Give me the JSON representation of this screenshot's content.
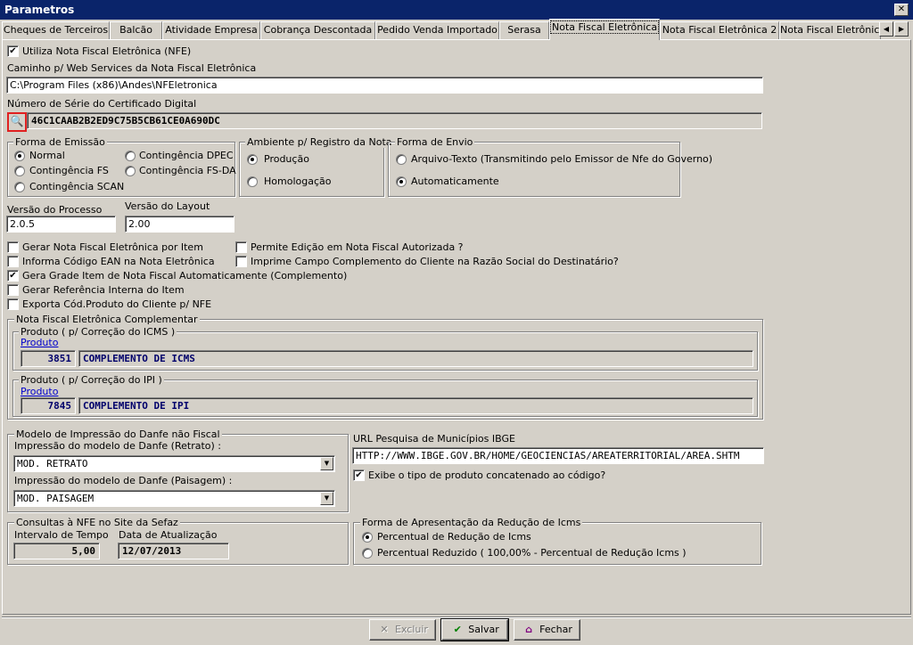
{
  "window": {
    "title": "Parametros",
    "close_glyph": "✕"
  },
  "tabs": [
    "Cheques de Terceiros",
    "Balcão",
    "Atividade Empresa",
    "Cobrança Descontada",
    "Pedido Venda Importado",
    "Serasa",
    "Nota Fiscal Eletrônica",
    "Nota Fiscal Eletrônica 2",
    "Nota Fiscal Eletrônica"
  ],
  "active_tab_index": 6,
  "tab_arrows": {
    "left": "◀",
    "right": "▶"
  },
  "nfe": {
    "use_nfe_label": "Utiliza Nota Fiscal Eletrônica (NFE)",
    "use_nfe_checked": true,
    "ws_path_label": "Caminho p/ Web Services da Nota Fiscal Eletrônica",
    "ws_path_value": "C:\\Program Files (x86)\\Andes\\NFEletronica",
    "cert_serial_label": "Número de Série do Certificado Digital",
    "cert_serial_value": "46C1CAAB2B2ED9C75B5CB61CE0A690DC",
    "cert_button_icon": "magnifier-icon"
  },
  "emissao": {
    "title": "Forma de Emissão",
    "options": [
      "Normal",
      "Contingência FS",
      "Contingência SCAN",
      "Contingência DPEC",
      "Contingência FS-DA"
    ],
    "selected": "Normal"
  },
  "ambiente": {
    "title": "Ambiente p/ Registro da Nota",
    "options": [
      "Produção",
      "Homologação"
    ],
    "selected": "Produção"
  },
  "envio": {
    "title": "Forma de Envio",
    "options": [
      "Arquivo-Texto (Transmitindo pelo Emissor de Nfe do Governo)",
      "Automaticamente"
    ],
    "selected": "Automaticamente"
  },
  "versao": {
    "processo_label": "Versão do Processo",
    "processo_value": "2.0.5",
    "layout_label": "Versão do Layout",
    "layout_value": "2.00"
  },
  "checks_left": [
    {
      "label": "Gerar Nota Fiscal Eletrônica por Item",
      "checked": false
    },
    {
      "label": "Informa Código EAN na Nota Eletrônica",
      "checked": false
    },
    {
      "label": "Gera Grade Item de Nota Fiscal Automaticamente (Complemento)",
      "checked": true
    },
    {
      "label": "Gerar Referência Interna do Item",
      "checked": false
    },
    {
      "label": "Exporta Cód.Produto do Cliente p/ NFE",
      "checked": false
    }
  ],
  "checks_right": [
    {
      "label": "Permite Edição em Nota Fiscal Autorizada ?",
      "checked": false
    },
    {
      "label": "Imprime Campo Complemento do Cliente na Razão Social do Destinatário?",
      "checked": false
    }
  ],
  "complementar": {
    "title": "Nota Fiscal Eletrônica Complementar",
    "icms": {
      "title": "Produto ( p/ Correção do ICMS )",
      "link": "Produto",
      "code": "3851",
      "desc": "COMPLEMENTO DE ICMS"
    },
    "ipi": {
      "title": "Produto ( p/ Correção do IPI )",
      "link": "Produto",
      "code": "7845",
      "desc": "COMPLEMENTO DE IPI"
    }
  },
  "danfe": {
    "title": "Modelo de Impressão do Danfe não Fiscal",
    "retrato_label": "Impressão do modelo de Danfe (Retrato) :",
    "retrato_value": "MOD. RETRATO",
    "paisagem_label": "Impressão do modelo de Danfe (Paisagem) :",
    "paisagem_value": "MOD. PAISAGEM",
    "dropdown_glyph": "▼"
  },
  "ibge": {
    "url_label": "URL Pesquisa de Municípios IBGE",
    "url_value": "HTTP://WWW.IBGE.GOV.BR/HOME/GEOCIENCIAS/AREATERRITORIAL/AREA.SHTM",
    "exibe_label": "Exibe o tipo de produto concatenado ao código?",
    "exibe_checked": true
  },
  "consultas": {
    "title": "Consultas à NFE no Site da Sefaz",
    "intervalo_label": "Intervalo de Tempo",
    "intervalo_value": "5,00",
    "data_label": "Data de Atualização",
    "data_value": "12/07/2013"
  },
  "reducao": {
    "title": "Forma de Apresentação da Redução de Icms",
    "options": [
      "Percentual de Redução de Icms",
      "Percentual Reduzido ( 100,00% - Percentual de Redução Icms )"
    ],
    "selected": "Percentual de Redução de Icms"
  },
  "buttons": {
    "excluir": "Excluir",
    "excluir_icon": "✕",
    "salvar": "Salvar",
    "salvar_icon": "✔",
    "fechar": "Fechar",
    "fechar_icon": "⌂"
  },
  "colors": {
    "titlebar": "#0a246a",
    "face": "#d4d0c8",
    "highlight_border": "#e02020",
    "link": "#0000cc"
  }
}
